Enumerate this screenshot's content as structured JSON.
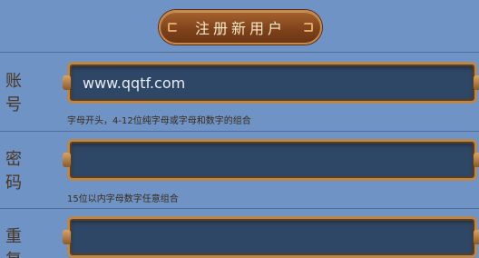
{
  "header": {
    "register_title": "注册新用户"
  },
  "form": {
    "account": {
      "label": "账号",
      "value": "www.qqtf.com",
      "hint": "字母开头，4-12位纯字母或字母和数字的组合"
    },
    "password": {
      "label": "密码",
      "value": "",
      "hint": "15位以内字母数字任意组合"
    },
    "repeat": {
      "label": "重复",
      "value": ""
    }
  }
}
